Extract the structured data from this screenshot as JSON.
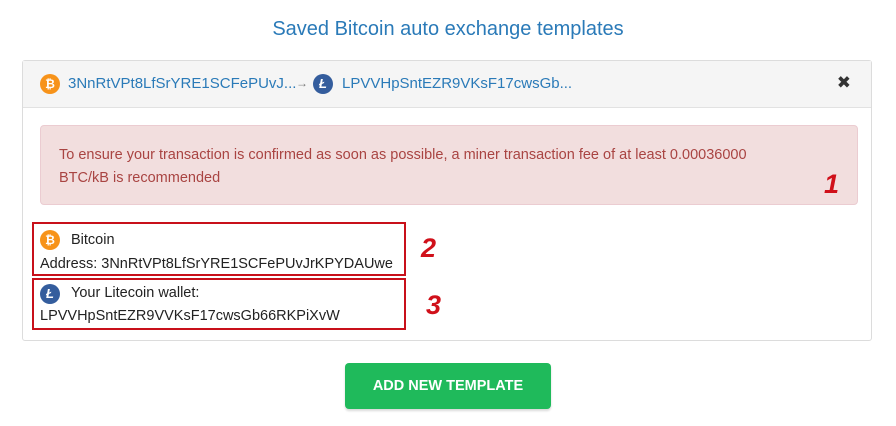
{
  "title": "Saved Bitcoin auto exchange templates",
  "template": {
    "from_coin_icon": "bitcoin-icon",
    "from_address_short": "3NnRtVPt8LfSrYRE1SCFePUvJ...",
    "arrow": "→",
    "to_coin_icon": "litecoin-icon",
    "to_address_short": "LPVVHpSntEZR9VKsF17cwsGb...",
    "close_symbol": "✖"
  },
  "alert": {
    "line1": "To ensure your transaction is confirmed as soon as possible, a miner transaction fee of at least 0.00036000",
    "line2": "BTC/kB is recommended"
  },
  "source": {
    "name": "Bitcoin",
    "address_label": "Address: 3NnRtVPt8LfSrYRE1SCFePUvJrKPYDAUwe"
  },
  "destination": {
    "label": "Your Litecoin wallet:",
    "address": "LPVVHpSntEZR9VVKsF17cwsGb66RKPiXvW"
  },
  "annotations": [
    "1",
    "2",
    "3"
  ],
  "add_button_label": "ADD NEW TEMPLATE",
  "colors": {
    "accent": "#2a7ab8",
    "alert_bg": "#f2dede",
    "alert_text": "#a94442",
    "annotation_red": "#c8101a",
    "button_green": "#1fba5b",
    "bitcoin": "#f7931a",
    "litecoin": "#345d9d"
  }
}
